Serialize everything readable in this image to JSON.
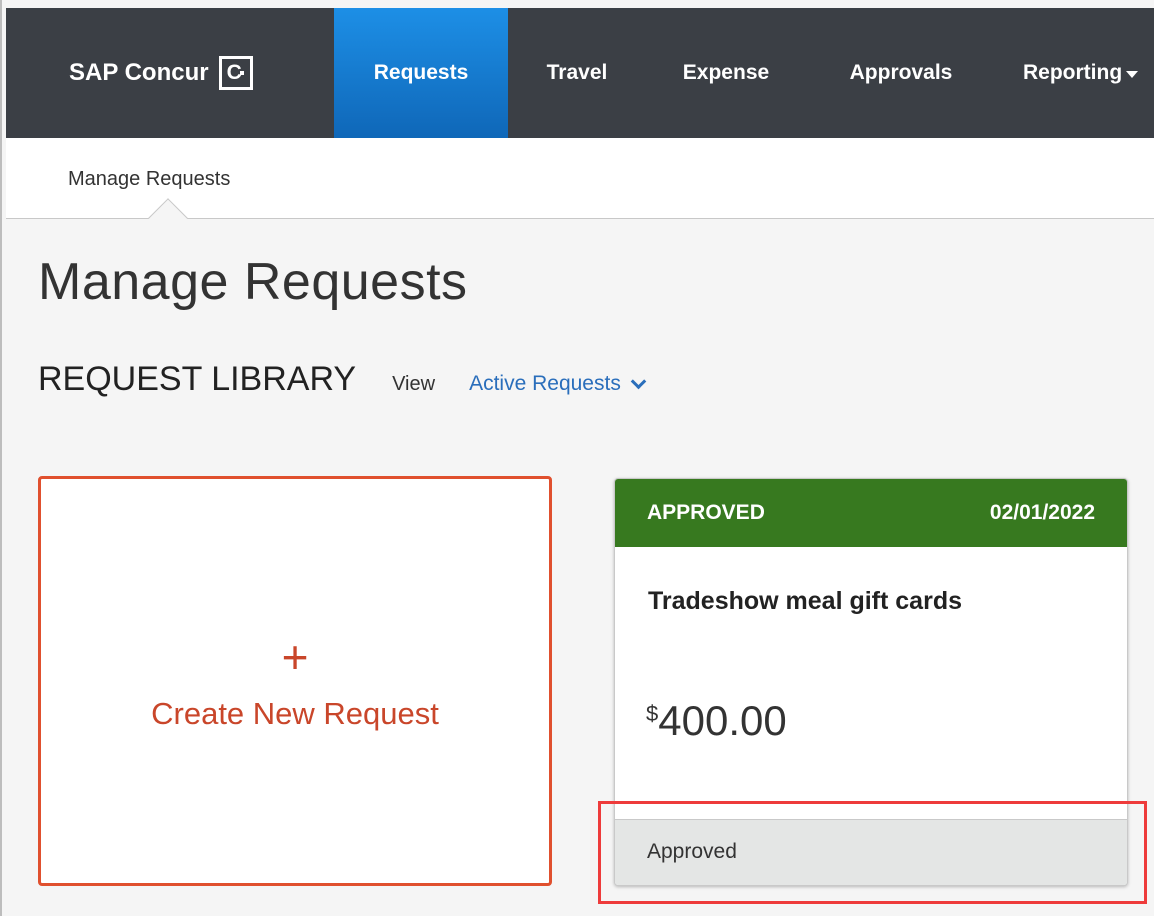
{
  "brand": {
    "name": "SAP Concur",
    "logo_glyph": "C"
  },
  "topnav": {
    "items": [
      {
        "label": "Requests",
        "active": true
      },
      {
        "label": "Travel"
      },
      {
        "label": "Expense"
      },
      {
        "label": "Approvals"
      },
      {
        "label": "Reporting",
        "has_dropdown": true
      }
    ]
  },
  "subnav": {
    "items": [
      {
        "label": "Manage Requests",
        "active": true
      }
    ]
  },
  "page": {
    "title": "Manage Requests",
    "library_title": "REQUEST LIBRARY",
    "view_label": "View",
    "view_selected": "Active Requests"
  },
  "create_card": {
    "icon": "+",
    "label": "Create New Request"
  },
  "request_card": {
    "status": "APPROVED",
    "date": "02/01/2022",
    "name": "Tradeshow meal gift cards",
    "currency_symbol": "$",
    "amount": "400.00",
    "footer_status": "Approved",
    "status_color": "#37791f"
  },
  "colors": {
    "nav_bg": "#3b3f45",
    "nav_active": "#1a7fd4",
    "accent_orange": "#e0502e",
    "link_blue": "#2a6ebb",
    "highlight_red": "#ee3b3b"
  }
}
